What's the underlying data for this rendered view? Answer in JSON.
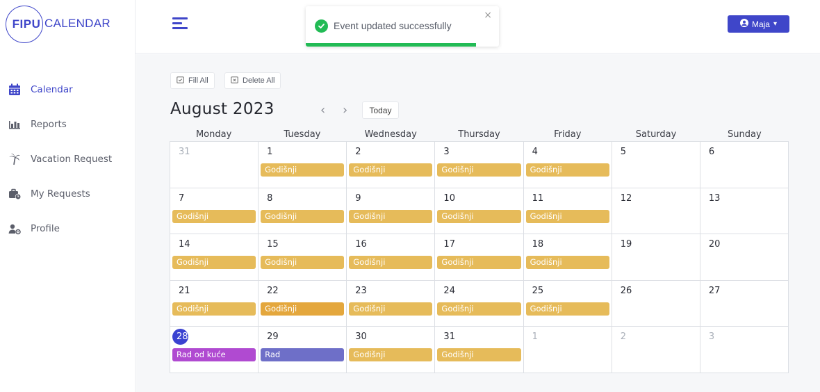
{
  "logo": {
    "mark": "FIPU",
    "text": "CALENDAR"
  },
  "sidebar": {
    "items": [
      {
        "label": "Calendar",
        "icon": "calendar-icon",
        "active": true
      },
      {
        "label": "Reports",
        "icon": "bar-chart-icon",
        "active": false
      },
      {
        "label": "Vacation Request",
        "icon": "palm-tree-icon",
        "active": false
      },
      {
        "label": "My Requests",
        "icon": "briefcase-clock-icon",
        "active": false
      },
      {
        "label": "Profile",
        "icon": "user-gear-icon",
        "active": false
      }
    ]
  },
  "header": {
    "user_label": "Maja",
    "user_icon": "user-circle-icon",
    "user_caret": "▾"
  },
  "toast": {
    "message": "Event updated successfully",
    "close": "×",
    "progress": 0.88,
    "color": "#22bb55"
  },
  "toolbar": {
    "fill_all": "Fill All",
    "delete_all": "Delete All",
    "today": "Today",
    "prev": "‹",
    "next": "›"
  },
  "calendar": {
    "title": "August 2023",
    "weekdays": [
      "Monday",
      "Tuesday",
      "Wednesday",
      "Thursday",
      "Friday",
      "Saturday",
      "Sunday"
    ],
    "colors": {
      "godisnji": "#e6bb5a",
      "godisnji_active": "#e4a73d",
      "rad_od_kuce": "#b04ad1",
      "rad": "#6e6fc8",
      "today": "#3a42d1"
    },
    "weeks": [
      [
        {
          "day": "31",
          "muted": true
        },
        {
          "day": "1",
          "event": "Godišnji",
          "color": "godisnji"
        },
        {
          "day": "2",
          "event": "Godišnji",
          "color": "godisnji"
        },
        {
          "day": "3",
          "event": "Godišnji",
          "color": "godisnji"
        },
        {
          "day": "4",
          "event": "Godišnji",
          "color": "godisnji"
        },
        {
          "day": "5"
        },
        {
          "day": "6"
        }
      ],
      [
        {
          "day": "7",
          "event": "Godišnji",
          "color": "godisnji"
        },
        {
          "day": "8",
          "event": "Godišnji",
          "color": "godisnji"
        },
        {
          "day": "9",
          "event": "Godišnji",
          "color": "godisnji"
        },
        {
          "day": "10",
          "event": "Godišnji",
          "color": "godisnji"
        },
        {
          "day": "11",
          "event": "Godišnji",
          "color": "godisnji"
        },
        {
          "day": "12"
        },
        {
          "day": "13"
        }
      ],
      [
        {
          "day": "14",
          "event": "Godišnji",
          "color": "godisnji"
        },
        {
          "day": "15",
          "event": "Godišnji",
          "color": "godisnji"
        },
        {
          "day": "16",
          "event": "Godišnji",
          "color": "godisnji"
        },
        {
          "day": "17",
          "event": "Godišnji",
          "color": "godisnji"
        },
        {
          "day": "18",
          "event": "Godišnji",
          "color": "godisnji"
        },
        {
          "day": "19"
        },
        {
          "day": "20"
        }
      ],
      [
        {
          "day": "21",
          "event": "Godišnji",
          "color": "godisnji"
        },
        {
          "day": "22",
          "event": "Godišnji",
          "color": "godisnji_active"
        },
        {
          "day": "23",
          "event": "Godišnji",
          "color": "godisnji"
        },
        {
          "day": "24",
          "event": "Godišnji",
          "color": "godisnji"
        },
        {
          "day": "25",
          "event": "Godišnji",
          "color": "godisnji"
        },
        {
          "day": "26"
        },
        {
          "day": "27"
        }
      ],
      [
        {
          "day": "28",
          "today": true,
          "event": "Rad od kuće",
          "color": "rad_od_kuce"
        },
        {
          "day": "29",
          "event": "Rad",
          "color": "rad"
        },
        {
          "day": "30",
          "event": "Godišnji",
          "color": "godisnji"
        },
        {
          "day": "31",
          "event": "Godišnji",
          "color": "godisnji"
        },
        {
          "day": "1",
          "muted": true
        },
        {
          "day": "2",
          "muted": true
        },
        {
          "day": "3",
          "muted": true
        }
      ]
    ]
  }
}
